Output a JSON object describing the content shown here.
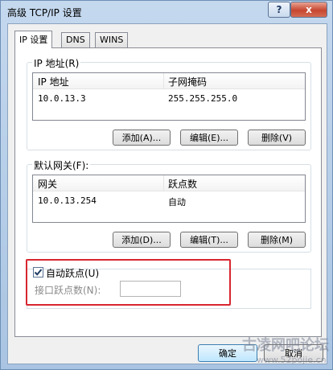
{
  "window": {
    "title": "高级 TCP/IP 设置",
    "help_label": "?",
    "close_label": "x"
  },
  "tabs": [
    {
      "label": "IP 设置",
      "active": true
    },
    {
      "label": "DNS",
      "active": false
    },
    {
      "label": "WINS",
      "active": false
    }
  ],
  "ip_group": {
    "label": "IP 地址(R)",
    "columns": [
      "IP 地址",
      "子网掩码"
    ],
    "rows": [
      {
        "ip": "10.0.13.3",
        "mask": "255.255.255.0"
      }
    ],
    "buttons": {
      "add": "添加(A)...",
      "edit": "编辑(E)...",
      "remove": "删除(V)"
    }
  },
  "gateway_group": {
    "label": "默认网关(F):",
    "columns": [
      "网关",
      "跃点数"
    ],
    "rows": [
      {
        "gateway": "10.0.13.254",
        "metric": "自动"
      }
    ],
    "buttons": {
      "add": "添加(D)...",
      "edit": "编辑(T)...",
      "remove": "删除(M)"
    }
  },
  "metric": {
    "auto_label": "自动跃点(U)",
    "auto_checked": true,
    "interface_label": "接口跃点数(N):",
    "interface_value": ""
  },
  "footer": {
    "ok": "确定",
    "cancel": "取消"
  },
  "watermark": {
    "text": "古凌网吧论坛",
    "url": "www.52pojie.cn"
  },
  "colors": {
    "highlight": "#d8262f",
    "tab_border": "#898c95"
  }
}
